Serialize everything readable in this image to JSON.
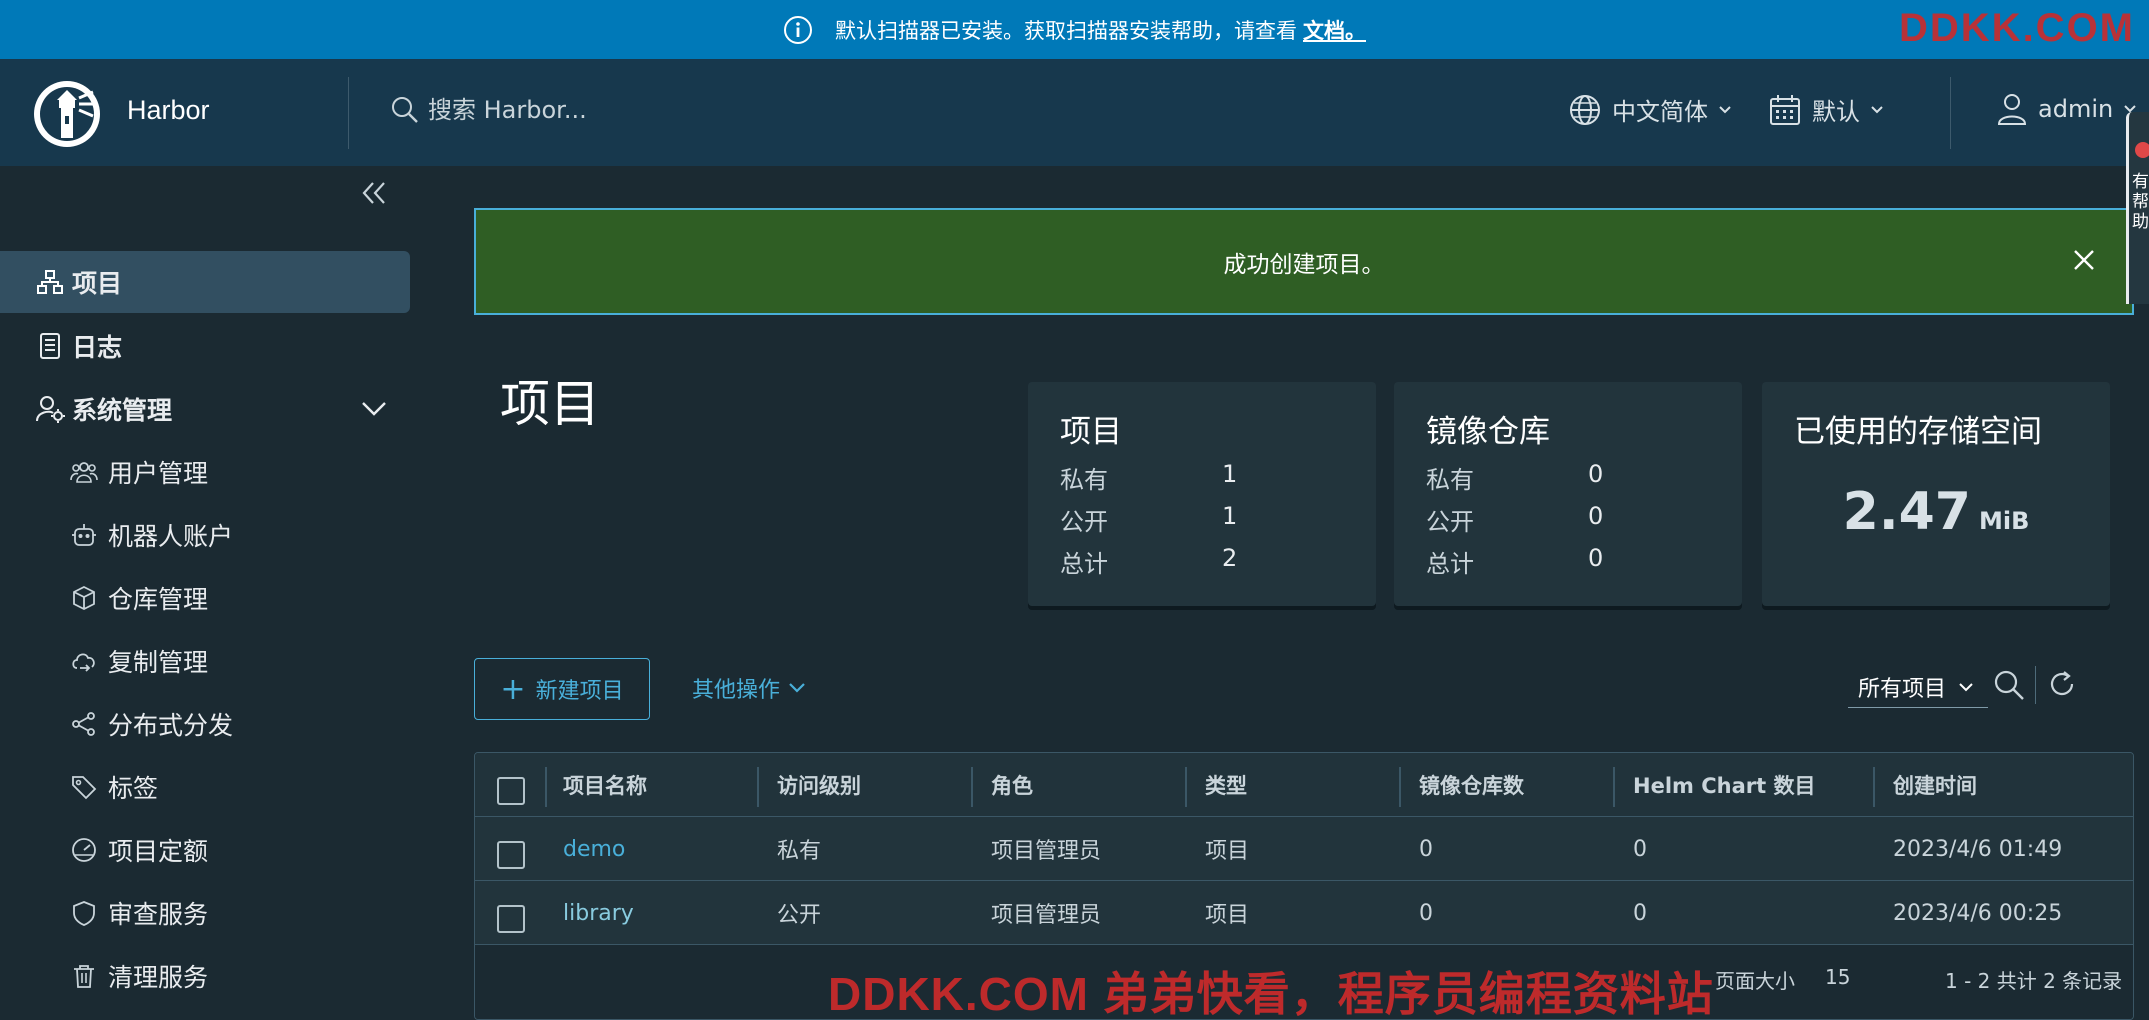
{
  "banner": {
    "message": "默认扫描器已安装。获取扫描器安装帮助，请查看",
    "link_text": "文档。",
    "watermark": "DDKK.COM"
  },
  "header": {
    "brand": "Harbor",
    "search_placeholder": "搜索 Harbor...",
    "language": "中文简体",
    "date_format": "默认",
    "user": "admin"
  },
  "sidebar": {
    "items": [
      {
        "label": "项目"
      },
      {
        "label": "日志"
      },
      {
        "label": "系统管理"
      },
      {
        "label": "用户管理"
      },
      {
        "label": "机器人账户"
      },
      {
        "label": "仓库管理"
      },
      {
        "label": "复制管理"
      },
      {
        "label": "分布式分发"
      },
      {
        "label": "标签"
      },
      {
        "label": "项目定额"
      },
      {
        "label": "审查服务"
      },
      {
        "label": "清理服务"
      }
    ]
  },
  "alert": {
    "message": "成功创建项目。"
  },
  "page": {
    "title": "项目"
  },
  "cards": {
    "projects": {
      "title": "项目",
      "private_label": "私有",
      "private": "1",
      "public_label": "公开",
      "public": "1",
      "total_label": "总计",
      "total": "2"
    },
    "repos": {
      "title": "镜像仓库",
      "private_label": "私有",
      "private": "0",
      "public_label": "公开",
      "public": "0",
      "total_label": "总计",
      "total": "0"
    },
    "storage": {
      "title": "已使用的存储空间",
      "value": "2.47",
      "unit": "MiB"
    }
  },
  "toolbar": {
    "new_project": "新建项目",
    "more_actions": "其他操作",
    "filter": "所有项目"
  },
  "table": {
    "headers": [
      "项目名称",
      "访问级别",
      "角色",
      "类型",
      "镜像仓库数",
      "Helm Chart 数目",
      "创建时间"
    ],
    "rows": [
      [
        "demo",
        "私有",
        "项目管理员",
        "项目",
        "0",
        "0",
        "2023/4/6 01:49"
      ],
      [
        "library",
        "公开",
        "项目管理员",
        "项目",
        "0",
        "0",
        "2023/4/6 00:25"
      ]
    ],
    "footer": {
      "page_size_label": "页面大小",
      "page_size": "15",
      "summary": "1 - 2 共计 2 条记录"
    }
  },
  "side_widget": {
    "text": "有帮助"
  },
  "footer_watermark": "DDKK.COM 弟弟快看，程序员编程资料站",
  "colors": {
    "banner": "#0079b8",
    "header": "#17384d",
    "accent": "#49afd9",
    "alert": "#2f5e24"
  }
}
